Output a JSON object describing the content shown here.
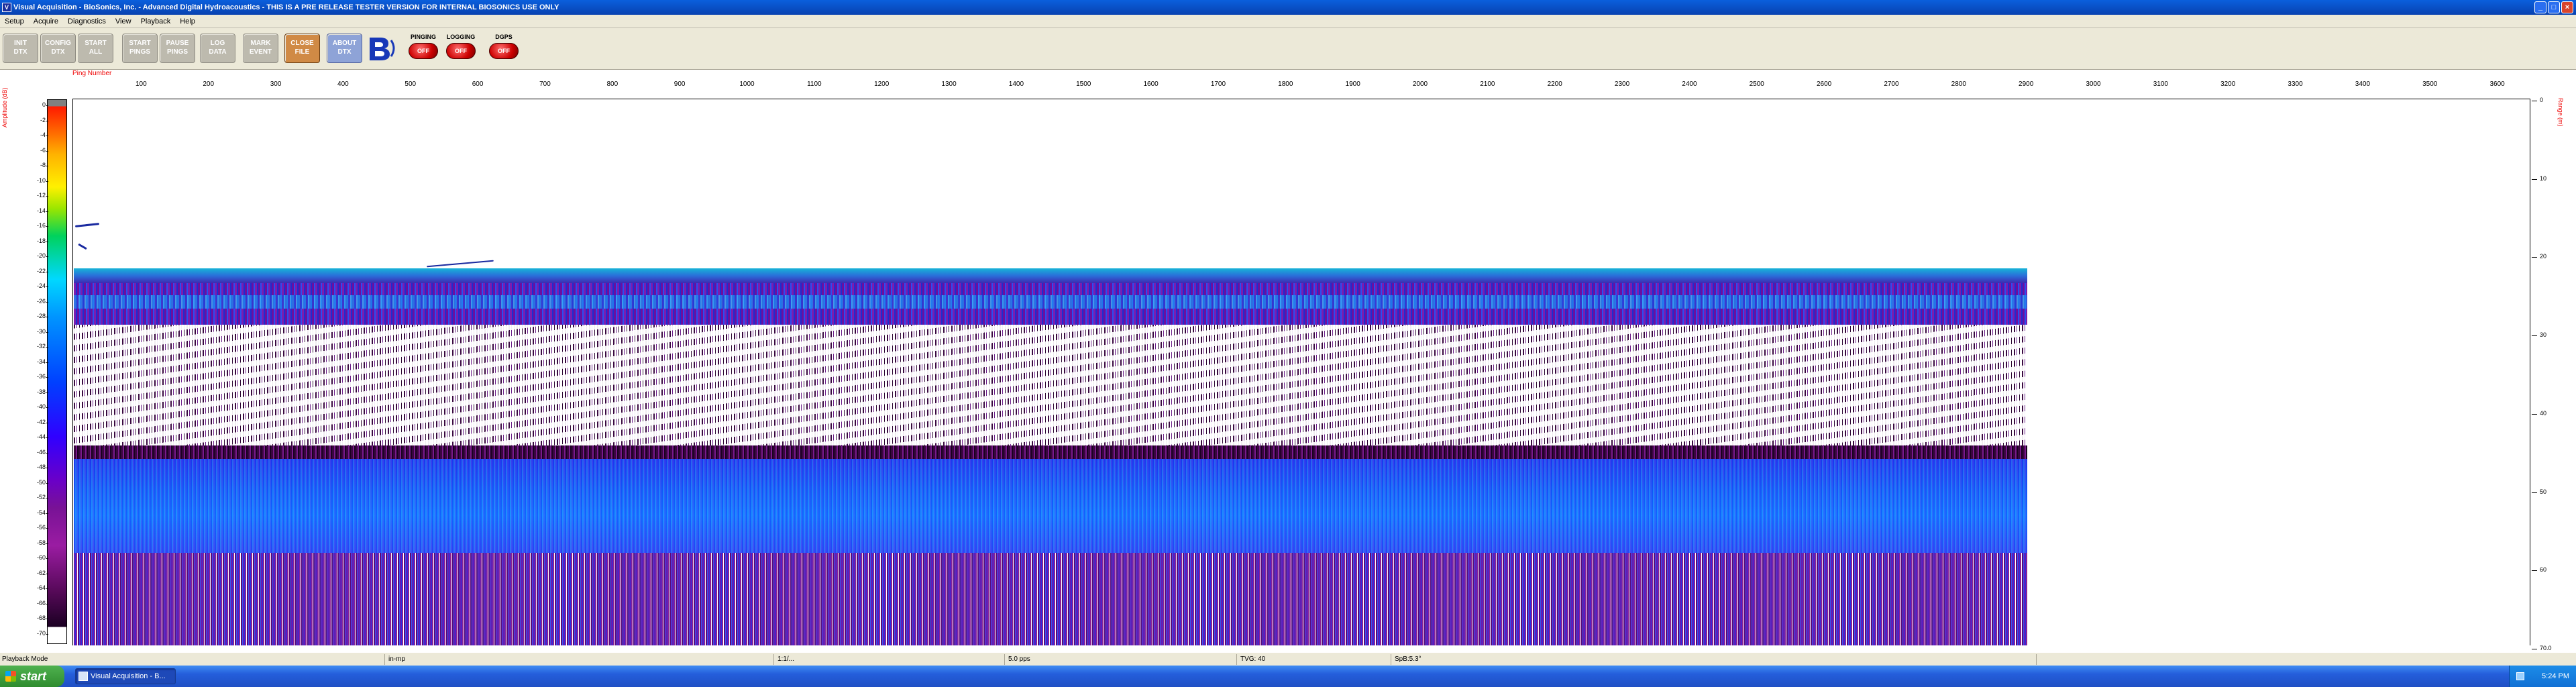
{
  "window": {
    "title": "Visual Acquisition  -  BioSonics, Inc.  -  Advanced Digital Hydroacoustics  -  THIS IS A PRE RELEASE TESTER VERSION FOR INTERNAL BIOSONICS USE ONLY",
    "min": "_",
    "max": "□",
    "close": "×"
  },
  "menu": [
    "Setup",
    "Acquire",
    "Diagnostics",
    "View",
    "Playback",
    "Help"
  ],
  "toolbar": {
    "buttons": [
      {
        "line1": "INIT",
        "line2": "DTX"
      },
      {
        "line1": "CONFIG",
        "line2": "DTX"
      },
      {
        "line1": "START",
        "line2": "ALL"
      },
      {
        "line1": "START",
        "line2": "PINGS"
      },
      {
        "line1": "PAUSE",
        "line2": "PINGS"
      },
      {
        "line1": "LOG",
        "line2": "DATA"
      },
      {
        "line1": "MARK",
        "line2": "EVENT"
      },
      {
        "line1": "CLOSE",
        "line2": "FILE"
      },
      {
        "line1": "ABOUT",
        "line2": "DTX"
      }
    ],
    "indicators": [
      {
        "label": "PINGING",
        "state": "OFF"
      },
      {
        "label": "LOGGING",
        "state": "OFF"
      },
      {
        "label": "DGPS",
        "state": "OFF"
      }
    ]
  },
  "echogram": {
    "ping_label": "Ping Number",
    "amplitude_label": "Amplitude (dB)",
    "range_label": "Range (m)",
    "ping_ticks": [
      "100",
      "200",
      "300",
      "400",
      "500",
      "600",
      "700",
      "800",
      "900",
      "1000",
      "1100",
      "1200",
      "1300",
      "1400",
      "1500",
      "1600",
      "1700",
      "1800",
      "1900",
      "2000",
      "2100",
      "2200",
      "2300",
      "2400",
      "2500",
      "2600",
      "2700",
      "2800",
      "2900",
      "3000",
      "3100",
      "3200",
      "3300",
      "3400",
      "3500",
      "3600"
    ],
    "amplitude_ticks": [
      "0",
      "-2",
      "-4",
      "-6",
      "-8",
      "-10",
      "-12",
      "-14",
      "-16",
      "-18",
      "-20",
      "-22",
      "-24",
      "-26",
      "-28",
      "-30",
      "-32",
      "-34",
      "-36",
      "-38",
      "-40",
      "-42",
      "-44",
      "-46",
      "-48",
      "-50",
      "-52",
      "-54",
      "-56",
      "-58",
      "-60",
      "-62",
      "-64",
      "-66",
      "-68",
      "-70"
    ],
    "range_ticks": [
      "0",
      "10",
      "20",
      "30",
      "40",
      "50",
      "60",
      "70.0"
    ]
  },
  "status": {
    "mode": "Playback Mode",
    "units": "in-mp",
    "field1": "1:1/...",
    "ping_rate": "5.0 pps",
    "tvg": "TVG: 40",
    "spb": "SpB:5.3°"
  },
  "taskbar": {
    "start": "start",
    "task": "Visual Acquisition - B...",
    "clock": "5:24 PM"
  }
}
